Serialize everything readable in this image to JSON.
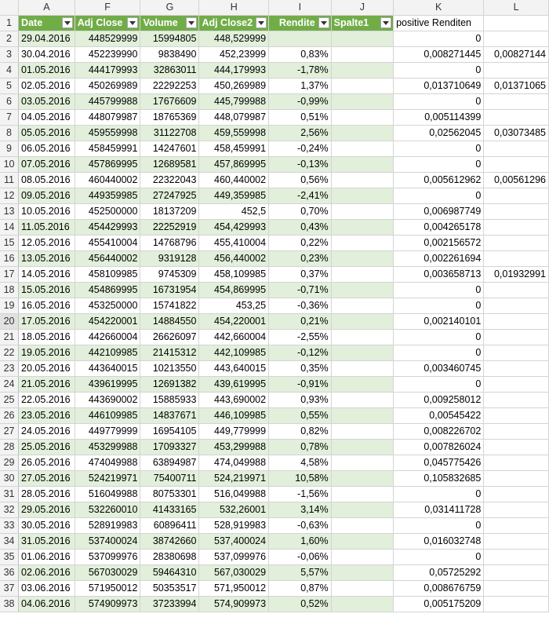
{
  "columns": [
    "A",
    "F",
    "G",
    "H",
    "I",
    "J",
    "K",
    "L"
  ],
  "headers": {
    "date": "Date",
    "adj_close": "Adj Close",
    "volume": "Volume",
    "adj_close2": "Adj Close2",
    "rendite": "Rendite",
    "spalte1": "Spalte1",
    "positive": "positive Renditen"
  },
  "rows": [
    {
      "n": "2",
      "date": "29.04.2016",
      "adj": "448529999",
      "vol": "15994805",
      "adj2": "448,529999",
      "rend": "",
      "k": "0",
      "l": ""
    },
    {
      "n": "3",
      "date": "30.04.2016",
      "adj": "452239990",
      "vol": "9838490",
      "adj2": "452,23999",
      "rend": "0,83%",
      "k": "0,008271445",
      "l": "0,00827144"
    },
    {
      "n": "4",
      "date": "01.05.2016",
      "adj": "444179993",
      "vol": "32863011",
      "adj2": "444,179993",
      "rend": "-1,78%",
      "k": "0",
      "l": ""
    },
    {
      "n": "5",
      "date": "02.05.2016",
      "adj": "450269989",
      "vol": "22292253",
      "adj2": "450,269989",
      "rend": "1,37%",
      "k": "0,013710649",
      "l": "0,01371065"
    },
    {
      "n": "6",
      "date": "03.05.2016",
      "adj": "445799988",
      "vol": "17676609",
      "adj2": "445,799988",
      "rend": "-0,99%",
      "k": "0",
      "l": ""
    },
    {
      "n": "7",
      "date": "04.05.2016",
      "adj": "448079987",
      "vol": "18765369",
      "adj2": "448,079987",
      "rend": "0,51%",
      "k": "0,005114399",
      "l": ""
    },
    {
      "n": "8",
      "date": "05.05.2016",
      "adj": "459559998",
      "vol": "31122708",
      "adj2": "459,559998",
      "rend": "2,56%",
      "k": "0,02562045",
      "l": "0,03073485"
    },
    {
      "n": "9",
      "date": "06.05.2016",
      "adj": "458459991",
      "vol": "14247601",
      "adj2": "458,459991",
      "rend": "-0,24%",
      "k": "0",
      "l": ""
    },
    {
      "n": "10",
      "date": "07.05.2016",
      "adj": "457869995",
      "vol": "12689581",
      "adj2": "457,869995",
      "rend": "-0,13%",
      "k": "0",
      "l": ""
    },
    {
      "n": "11",
      "date": "08.05.2016",
      "adj": "460440002",
      "vol": "22322043",
      "adj2": "460,440002",
      "rend": "0,56%",
      "k": "0,005612962",
      "l": "0,00561296"
    },
    {
      "n": "12",
      "date": "09.05.2016",
      "adj": "449359985",
      "vol": "27247925",
      "adj2": "449,359985",
      "rend": "-2,41%",
      "k": "0",
      "l": ""
    },
    {
      "n": "13",
      "date": "10.05.2016",
      "adj": "452500000",
      "vol": "18137209",
      "adj2": "452,5",
      "rend": "0,70%",
      "k": "0,006987749",
      "l": ""
    },
    {
      "n": "14",
      "date": "11.05.2016",
      "adj": "454429993",
      "vol": "22252919",
      "adj2": "454,429993",
      "rend": "0,43%",
      "k": "0,004265178",
      "l": ""
    },
    {
      "n": "15",
      "date": "12.05.2016",
      "adj": "455410004",
      "vol": "14768796",
      "adj2": "455,410004",
      "rend": "0,22%",
      "k": "0,002156572",
      "l": ""
    },
    {
      "n": "16",
      "date": "13.05.2016",
      "adj": "456440002",
      "vol": "9319128",
      "adj2": "456,440002",
      "rend": "0,23%",
      "k": "0,002261694",
      "l": ""
    },
    {
      "n": "17",
      "date": "14.05.2016",
      "adj": "458109985",
      "vol": "9745309",
      "adj2": "458,109985",
      "rend": "0,37%",
      "k": "0,003658713",
      "l": "0,01932991"
    },
    {
      "n": "18",
      "date": "15.05.2016",
      "adj": "454869995",
      "vol": "16731954",
      "adj2": "454,869995",
      "rend": "-0,71%",
      "k": "0",
      "l": ""
    },
    {
      "n": "19",
      "date": "16.05.2016",
      "adj": "453250000",
      "vol": "15741822",
      "adj2": "453,25",
      "rend": "-0,36%",
      "k": "0",
      "l": ""
    },
    {
      "n": "20",
      "date": "17.05.2016",
      "adj": "454220001",
      "vol": "14884550",
      "adj2": "454,220001",
      "rend": "0,21%",
      "k": "0,002140101",
      "l": ""
    },
    {
      "n": "21",
      "date": "18.05.2016",
      "adj": "442660004",
      "vol": "26626097",
      "adj2": "442,660004",
      "rend": "-2,55%",
      "k": "0",
      "l": ""
    },
    {
      "n": "22",
      "date": "19.05.2016",
      "adj": "442109985",
      "vol": "21415312",
      "adj2": "442,109985",
      "rend": "-0,12%",
      "k": "0",
      "l": ""
    },
    {
      "n": "23",
      "date": "20.05.2016",
      "adj": "443640015",
      "vol": "10213550",
      "adj2": "443,640015",
      "rend": "0,35%",
      "k": "0,003460745",
      "l": ""
    },
    {
      "n": "24",
      "date": "21.05.2016",
      "adj": "439619995",
      "vol": "12691382",
      "adj2": "439,619995",
      "rend": "-0,91%",
      "k": "0",
      "l": ""
    },
    {
      "n": "25",
      "date": "22.05.2016",
      "adj": "443690002",
      "vol": "15885933",
      "adj2": "443,690002",
      "rend": "0,93%",
      "k": "0,009258012",
      "l": ""
    },
    {
      "n": "26",
      "date": "23.05.2016",
      "adj": "446109985",
      "vol": "14837671",
      "adj2": "446,109985",
      "rend": "0,55%",
      "k": "0,00545422",
      "l": ""
    },
    {
      "n": "27",
      "date": "24.05.2016",
      "adj": "449779999",
      "vol": "16954105",
      "adj2": "449,779999",
      "rend": "0,82%",
      "k": "0,008226702",
      "l": ""
    },
    {
      "n": "28",
      "date": "25.05.2016",
      "adj": "453299988",
      "vol": "17093327",
      "adj2": "453,299988",
      "rend": "0,78%",
      "k": "0,007826024",
      "l": ""
    },
    {
      "n": "29",
      "date": "26.05.2016",
      "adj": "474049988",
      "vol": "63894987",
      "adj2": "474,049988",
      "rend": "4,58%",
      "k": "0,045775426",
      "l": ""
    },
    {
      "n": "30",
      "date": "27.05.2016",
      "adj": "524219971",
      "vol": "75400711",
      "adj2": "524,219971",
      "rend": "10,58%",
      "k": "0,105832685",
      "l": ""
    },
    {
      "n": "31",
      "date": "28.05.2016",
      "adj": "516049988",
      "vol": "80753301",
      "adj2": "516,049988",
      "rend": "-1,56%",
      "k": "0",
      "l": ""
    },
    {
      "n": "32",
      "date": "29.05.2016",
      "adj": "532260010",
      "vol": "41433165",
      "adj2": "532,26001",
      "rend": "3,14%",
      "k": "0,031411728",
      "l": ""
    },
    {
      "n": "33",
      "date": "30.05.2016",
      "adj": "528919983",
      "vol": "60896411",
      "adj2": "528,919983",
      "rend": "-0,63%",
      "k": "0",
      "l": ""
    },
    {
      "n": "34",
      "date": "31.05.2016",
      "adj": "537400024",
      "vol": "38742660",
      "adj2": "537,400024",
      "rend": "1,60%",
      "k": "0,016032748",
      "l": ""
    },
    {
      "n": "35",
      "date": "01.06.2016",
      "adj": "537099976",
      "vol": "28380698",
      "adj2": "537,099976",
      "rend": "-0,06%",
      "k": "0",
      "l": ""
    },
    {
      "n": "36",
      "date": "02.06.2016",
      "adj": "567030029",
      "vol": "59464310",
      "adj2": "567,030029",
      "rend": "5,57%",
      "k": "0,05725292",
      "l": ""
    },
    {
      "n": "37",
      "date": "03.06.2016",
      "adj": "571950012",
      "vol": "50353517",
      "adj2": "571,950012",
      "rend": "0,87%",
      "k": "0,008676759",
      "l": ""
    },
    {
      "n": "38",
      "date": "04.06.2016",
      "adj": "574909973",
      "vol": "37233994",
      "adj2": "574,909973",
      "rend": "0,52%",
      "k": "0,005175209",
      "l": ""
    }
  ],
  "selected_row": "20",
  "colors": {
    "header_green": "#70ad47",
    "band_green": "#e2efda"
  }
}
